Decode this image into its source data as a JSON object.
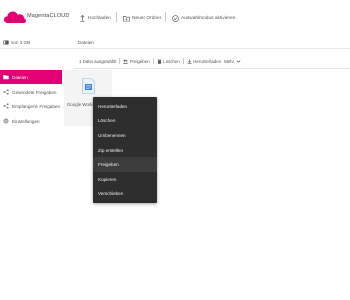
{
  "app": {
    "name": "MagentaCLOUD"
  },
  "topbar": {
    "upload": "Hochladen",
    "new_folder": "Neuer Ordner",
    "select_mode": "Auswahlmodus aktivieren"
  },
  "storage": {
    "label": "von 3 GB"
  },
  "breadcrumb": {
    "root": "Dateien"
  },
  "sidebar": {
    "items": [
      {
        "label": "Dateien",
        "icon": "folder-icon",
        "active": true
      },
      {
        "label": "Gesendete Freigaben",
        "icon": "share-sent-icon",
        "active": false
      },
      {
        "label": "Empfangene Freigaben",
        "icon": "share-received-icon",
        "active": false
      },
      {
        "label": "Einstellungen",
        "icon": "gear-icon",
        "active": false
      }
    ]
  },
  "selection": {
    "count_text": "1 Datei ausgewählt",
    "share": "Freigeben",
    "delete": "Löschen",
    "download": "Herunterladen",
    "more": "Mehr"
  },
  "file": {
    "name": "Google Worksp"
  },
  "context_menu": {
    "items": [
      "Herunterladen",
      "Löschen",
      "Umbenennen",
      "Zip erstellen",
      "Freigeben",
      "Kopieren",
      "Verschieben"
    ],
    "highlighted_index": 4
  },
  "colors": {
    "accent": "#e20074",
    "menu_bg": "#2e2e2e"
  }
}
